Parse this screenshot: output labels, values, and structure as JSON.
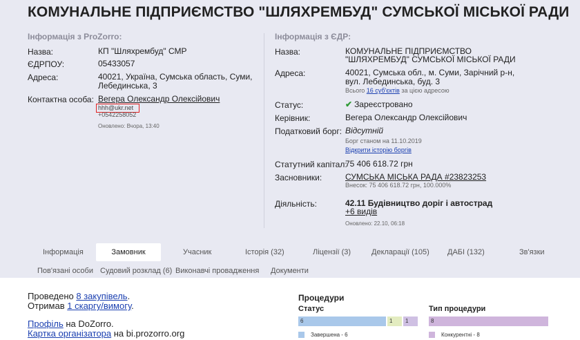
{
  "title": "КОМУНАЛЬНЕ ПІДПРИЄМСТВО \"ШЛЯХРЕМБУД\" СУМСЬКОЇ МІСЬКОЇ РАДИ",
  "prozorro": {
    "heading": "Інформація з ProZorro:",
    "name_label": "Назва:",
    "name": "КП \"Шляхрембуд\" СМР",
    "edrpou_label": "ЄДРПОУ:",
    "edrpou": "05433057",
    "address_label": "Адреса:",
    "address_1": "40021, Україна, Сумська область, Суми,",
    "address_2": "Лебединська, 3",
    "contact_label": "Контактна особа:",
    "contact_name": "Вегера Олександр Олексійович",
    "contact_email": "hhh@ukr.net",
    "contact_phone": "+0542258052",
    "updated": "Оновлено: Вчора, 13:40"
  },
  "edr": {
    "heading": "Інформація з ЄДР:",
    "name_label": "Назва:",
    "name_1": "КОМУНАЛЬНЕ ПІДПРИЄМСТВО",
    "name_2": "\"ШЛЯХРЕМБУД\" СУМСЬКОЇ МІСЬКОЇ РАДИ",
    "address_label": "Адреса:",
    "address_1": "40021, Сумська обл., м. Суми, Зарічний р-н,",
    "address_2": "вул. Лебединська, буд. 3",
    "entities_prefix": "Всього ",
    "entities_link": "16 суб'єктів",
    "entities_suffix": " за цією адресою",
    "status_label": "Статус:",
    "status": "Зареєстровано",
    "head_label": "Керівник:",
    "head": "Вегера Олександр Олексійович",
    "tax_label": "Податковий борг:",
    "tax": "Відсутній",
    "tax_date": "Борг станом на 11.10.2019",
    "tax_history": "Відкрити історію боргів",
    "capital_label": "Статутний капітал:",
    "capital": "75 406 618.72 грн",
    "founders_label": "Засновники:",
    "founder": "СУМСЬКА МІСЬКА РАДА #23823253",
    "founder_share": "Внесок: 75 406 618.72 грн, 100.000%",
    "activity_label": "Діяльність:",
    "activity": "42.11 Будівництво доріг і автострад",
    "activity_more": "+6 видів",
    "updated": "Оновлено: 22.10, 06:18"
  },
  "tabs": {
    "info": "Інформація",
    "customer": "Замовник",
    "participant": "Учасник",
    "history": "Історія (32)",
    "licenses": "Ліцензії (3)",
    "declarations": "Декларації (105)",
    "dabi": "ДАБІ (132)",
    "links": "Зв'язки",
    "related": "Пов'язані особи",
    "court": "Судовий розклад (6)",
    "enforcement": "Виконавчі провадження",
    "documents": "Документи"
  },
  "summary": {
    "held_prefix": "Проведено ",
    "held_link": "8 закупівель",
    "held_suffix": ".",
    "got_prefix": "Отримав ",
    "got_link": "1 скаргу/вимогу",
    "got_suffix": ".",
    "profile_link": "Профіль",
    "profile_suffix": " на DoZorro.",
    "card_link": "Картка організатора",
    "card_suffix": " на bi.prozorro.org"
  },
  "procedures": {
    "heading": "Процедури",
    "status_heading": "Статус",
    "type_heading": "Тип процедури",
    "status_bars": [
      {
        "label": "6",
        "value": 6,
        "color": "#a9c8ea"
      },
      {
        "label": "1",
        "value": 1,
        "color": "#e3ecc0"
      },
      {
        "label": "1",
        "value": 1,
        "color": "#cfc0e3"
      }
    ],
    "status_legend": "Завершена - 6",
    "status_legend_color": "#a9c8ea",
    "type_bar_label": "8",
    "type_bar_color": "#cfb5dc",
    "type_legend": "Конкурентні - 8",
    "type_legend_color": "#cfb5dc"
  }
}
